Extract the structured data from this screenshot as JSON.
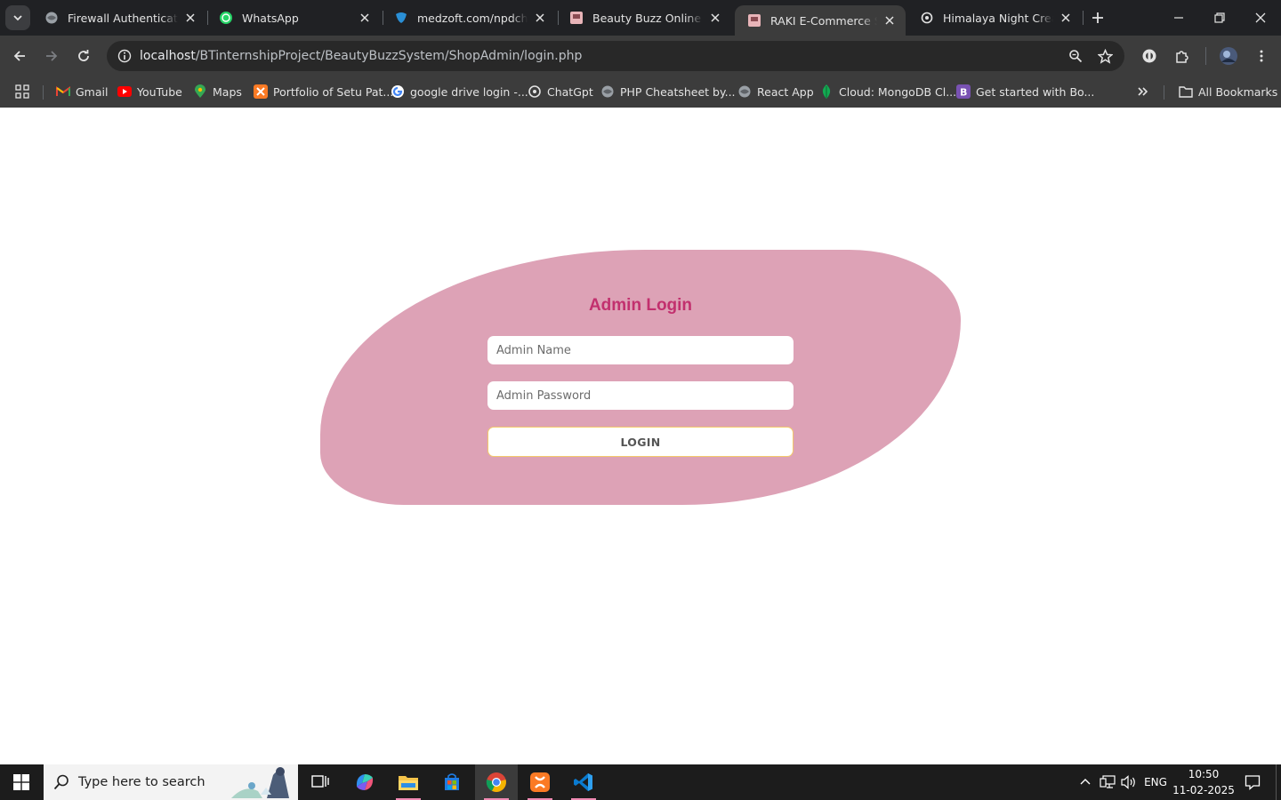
{
  "browser": {
    "tabs": [
      {
        "title": "Firewall Authentication",
        "icon": "globe-icon",
        "active": false
      },
      {
        "title": "WhatsApp",
        "icon": "whatsapp-icon",
        "active": false
      },
      {
        "title": "medzoft.com/npdch/Vis",
        "icon": "medzoft-icon",
        "active": false
      },
      {
        "title": "Beauty Buzz Online Syst",
        "icon": "page-icon",
        "active": false
      },
      {
        "title": "RAKI E-Commerce Shop",
        "icon": "page-icon",
        "active": true
      },
      {
        "title": "Himalaya Night Cream",
        "icon": "openai-icon",
        "active": false
      }
    ],
    "address": {
      "host": "localhost",
      "path": "/BTinternshipProject/BeautyBuzzSystem/ShopAdmin/login.php"
    },
    "bookmarks": [
      {
        "label": "Gmail",
        "icon": "gmail-icon"
      },
      {
        "label": "YouTube",
        "icon": "youtube-icon"
      },
      {
        "label": "Maps",
        "icon": "maps-icon"
      },
      {
        "label": "Portfolio of Setu Pat...",
        "icon": "xampp-icon"
      },
      {
        "label": "google drive login -...",
        "icon": "google-icon"
      },
      {
        "label": "ChatGpt",
        "icon": "openai-icon"
      },
      {
        "label": "PHP Cheatsheet by...",
        "icon": "globe-icon"
      },
      {
        "label": "React App",
        "icon": "globe-icon"
      },
      {
        "label": "Cloud: MongoDB Cl...",
        "icon": "mongodb-icon"
      },
      {
        "label": "Get started with Bo...",
        "icon": "bootstrap-icon"
      }
    ],
    "all_bookmarks_label": "All Bookmarks"
  },
  "login": {
    "title": "Admin Login",
    "name_placeholder": "Admin Name",
    "password_placeholder": "Admin Password",
    "button_label": "LOGIN"
  },
  "taskbar": {
    "search_placeholder": "Type here to search",
    "language": "ENG",
    "time": "10:50",
    "date": "11-02-2025"
  },
  "colors": {
    "blob": "#dda2b6",
    "title": "#c2306e",
    "button_border": "#f3c96b"
  }
}
